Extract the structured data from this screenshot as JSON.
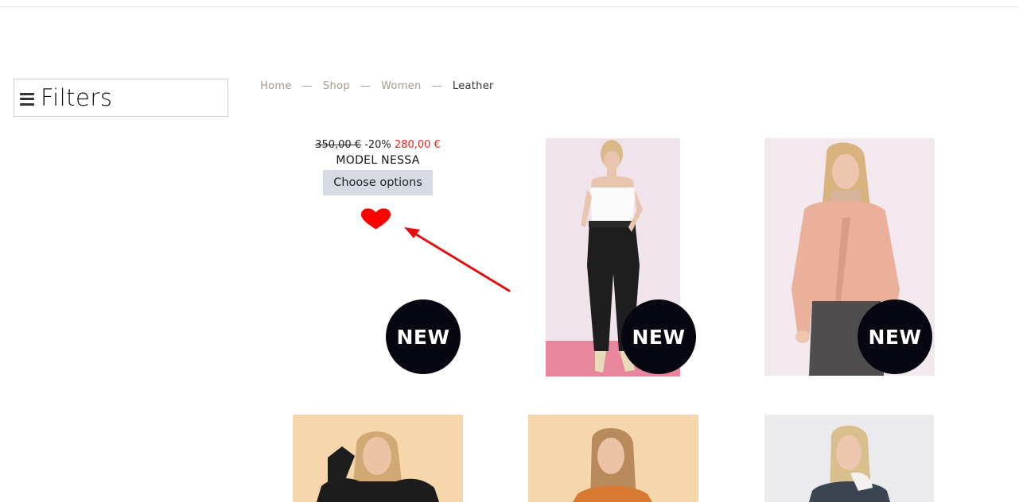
{
  "filters": {
    "label": "Filters"
  },
  "breadcrumb": {
    "items": [
      "Home",
      "Shop",
      "Women",
      "Leather"
    ],
    "separator": "—"
  },
  "products": [
    {
      "name": "MODEL NESSA",
      "old_price": "350,00 €",
      "discount": "-20%",
      "new_price": "280,00 €",
      "button_label": "Choose options",
      "badge": "NEW",
      "wishlisted": true
    },
    {
      "badge": "NEW",
      "image": "woman-black-leather-pants"
    },
    {
      "badge": "NEW",
      "image": "woman-pink-leather-jacket"
    },
    {
      "image": "woman-black-leather-jacket"
    },
    {
      "image": "woman-orange-leather-jacket"
    },
    {
      "image": "woman-patterned-shearling-coat"
    }
  ],
  "colors": {
    "sale_price": "#e02424",
    "badge_bg": "#070712",
    "button_bg": "#d7d9e3",
    "heart": "#ff0000",
    "annotation_arrow": "#e01010"
  }
}
